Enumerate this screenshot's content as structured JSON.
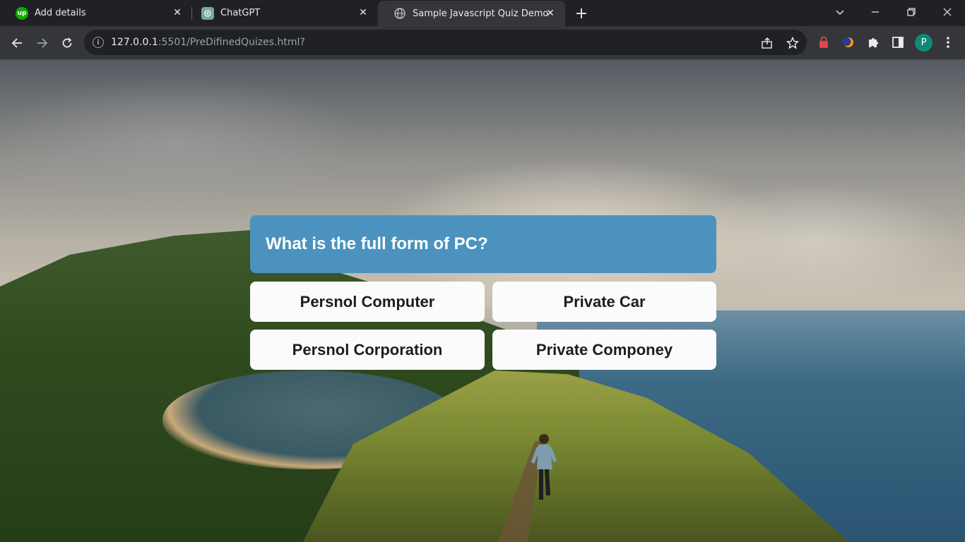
{
  "browser": {
    "tabs": [
      {
        "title": "Add details",
        "favicon": "upwork-icon",
        "favicon_color": "#14a800",
        "favicon_text": "up",
        "active": false
      },
      {
        "title": "ChatGPT",
        "favicon": "chatgpt-icon",
        "favicon_color": "#74aa9c",
        "active": false
      },
      {
        "title": "Sample Javascript Quiz Demo",
        "favicon": "globe-icon",
        "active": true
      }
    ],
    "address": {
      "host": "127.0.0.1",
      "rest": ":5501/PreDifinedQuizes.html?"
    },
    "profile_initial": "P",
    "profile_color": "#0f8a78"
  },
  "quiz": {
    "question": "What is the full form of PC?",
    "question_bg": "#4b92bf",
    "answers": [
      {
        "label": "Persnol Computer"
      },
      {
        "label": "Private Car"
      },
      {
        "label": "Persnol Corporation"
      },
      {
        "label": "Private Componey"
      }
    ]
  }
}
